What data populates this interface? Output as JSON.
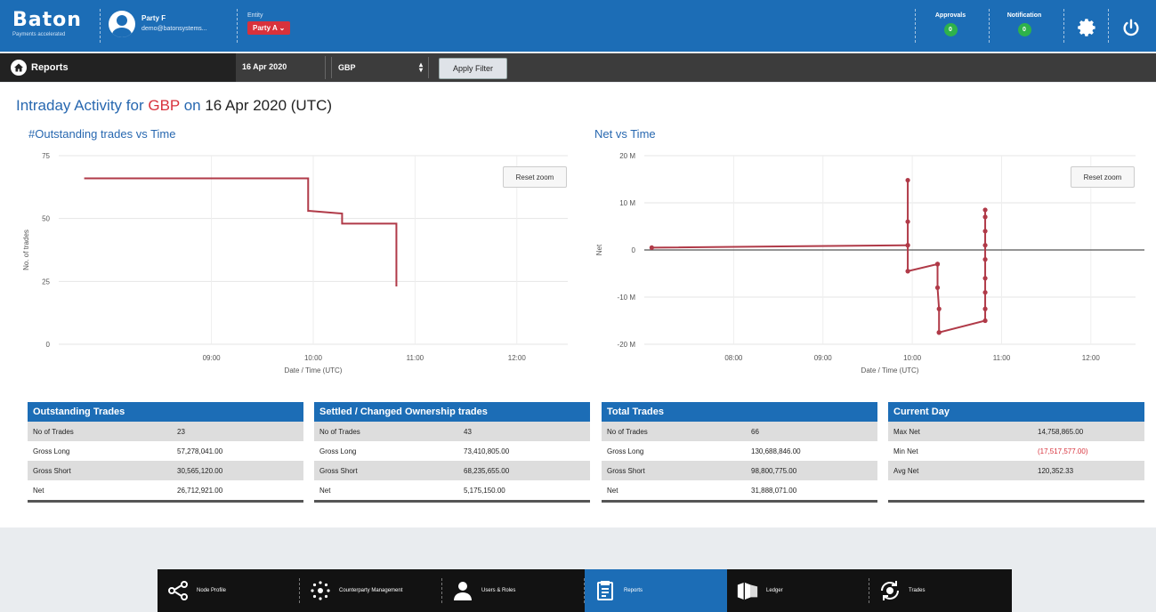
{
  "app": {
    "logo": "Baton",
    "logo_sub": "Payments accelerated",
    "user_name": "Party F",
    "user_email": "demo@batonsystems...",
    "entity_label": "Entity",
    "entity_value": "Party A ⌄"
  },
  "header": {
    "approvals_label": "Approvals",
    "approvals_count": "0",
    "notification_label": "Notification",
    "notification_count": "0"
  },
  "filter": {
    "section": "Reports",
    "date": "16 Apr 2020",
    "currency": "GBP",
    "apply_label": "Apply Filter"
  },
  "page": {
    "title_prefix": "Intraday Activity for",
    "title_ccy": "GBP",
    "title_on": "on",
    "title_date": "16 Apr 2020 (UTC)"
  },
  "charts": {
    "reset_label": "Reset zoom"
  },
  "chart_data": [
    {
      "type": "line",
      "title": "#Outstanding trades vs Time",
      "xlabel": "Date / Time (UTC)",
      "ylabel": "No. of trades",
      "x_ticks": [
        "09:00",
        "10:00",
        "11:00",
        "12:00"
      ],
      "y_ticks": [
        "0",
        "25",
        "50",
        "75"
      ],
      "ylim": [
        0,
        75
      ],
      "grid": true,
      "series": [
        {
          "color": "#b03a48",
          "x": [
            "07:45",
            "09:57",
            "09:57",
            "09:57",
            "09:58",
            "10:17",
            "10:17",
            "10:18",
            "10:49",
            "10:49"
          ],
          "y": [
            66,
            66,
            62,
            53,
            53,
            52,
            48,
            48,
            48,
            23
          ]
        }
      ]
    },
    {
      "type": "line",
      "title": "Net vs Time",
      "xlabel": "Date / Time (UTC)",
      "ylabel": "Net",
      "x_ticks": [
        "08:00",
        "09:00",
        "10:00",
        "11:00",
        "12:00"
      ],
      "y_ticks": [
        "20 M",
        "10 M",
        "0",
        "-10 M",
        "-20 M"
      ],
      "ylim": [
        -20,
        20
      ],
      "grid": true,
      "series": [
        {
          "color": "#b03a48",
          "x": [
            "07:05",
            "09:57",
            "09:57",
            "09:57",
            "09:57",
            "09:57",
            "10:17",
            "10:17",
            "10:17",
            "10:18",
            "10:18",
            "10:18",
            "10:49",
            "10:49",
            "10:49",
            "10:49",
            "10:49",
            "10:49",
            "10:49",
            "10:49",
            "10:49"
          ],
          "y": [
            0.5,
            1,
            6,
            14.8,
            1,
            -4.5,
            -3,
            -3,
            -8,
            -12.5,
            -17.5,
            -17.5,
            -15,
            -12.5,
            -9,
            -6,
            -2,
            1,
            4,
            7,
            8.5
          ]
        }
      ]
    }
  ],
  "tables": [
    {
      "title": "Outstanding Trades",
      "rows": [
        {
          "k": "No of Trades",
          "v": "23"
        },
        {
          "k": "Gross Long",
          "v": "57,278,041.00"
        },
        {
          "k": "Gross Short",
          "v": "30,565,120.00"
        },
        {
          "k": "Net",
          "v": "26,712,921.00"
        }
      ]
    },
    {
      "title": "Settled / Changed Ownership trades",
      "rows": [
        {
          "k": "No of Trades",
          "v": "43"
        },
        {
          "k": "Gross Long",
          "v": "73,410,805.00"
        },
        {
          "k": "Gross Short",
          "v": "68,235,655.00"
        },
        {
          "k": "Net",
          "v": "5,175,150.00"
        }
      ]
    },
    {
      "title": "Total Trades",
      "rows": [
        {
          "k": "No of Trades",
          "v": "66"
        },
        {
          "k": "Gross Long",
          "v": "130,688,846.00"
        },
        {
          "k": "Gross Short",
          "v": "98,800,775.00"
        },
        {
          "k": "Net",
          "v": "31,888,071.00"
        }
      ]
    },
    {
      "title": "Current Day",
      "rows": [
        {
          "k": "Max Net",
          "v": "14,758,865.00"
        },
        {
          "k": "Min Net",
          "v": "(17,517,577.00)"
        },
        {
          "k": "Avg Net",
          "v": "120,352.33"
        },
        {
          "k": "",
          "v": ""
        }
      ]
    }
  ],
  "bottom_nav": [
    {
      "label": "Node Profile",
      "icon": "node-icon"
    },
    {
      "label": "Counterparty Management",
      "icon": "network-icon"
    },
    {
      "label": "Users & Roles",
      "icon": "user-icon"
    },
    {
      "label": "Reports",
      "icon": "report-icon",
      "active": true
    },
    {
      "label": "Ledger",
      "icon": "ledger-icon"
    },
    {
      "label": "Trades",
      "icon": "trades-icon"
    }
  ]
}
